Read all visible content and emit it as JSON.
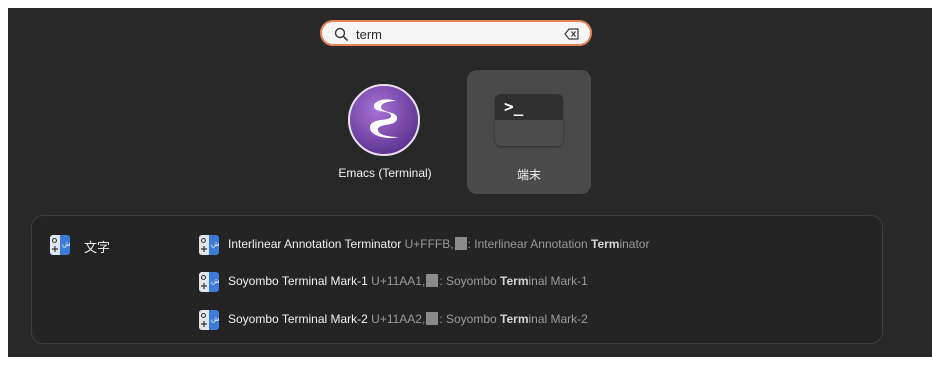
{
  "search": {
    "value": "term"
  },
  "apps": [
    {
      "name": "Emacs (Terminal)",
      "icon": "emacs-icon"
    },
    {
      "name": "端末",
      "icon": "terminal-icon",
      "selected": true
    }
  ],
  "results": {
    "provider": {
      "name": "文字",
      "icon": "characters-app-icon"
    },
    "items": [
      {
        "title": "Interlinear Annotation Terminator",
        "code": "U+FFFB,",
        "desc_prefix": ": Interlinear Annotation ",
        "desc_match": "Term",
        "desc_suffix": "inator"
      },
      {
        "title": "Soyombo Terminal Mark-1",
        "code": "U+11AA1,",
        "desc_prefix": ": Soyombo ",
        "desc_match": "Term",
        "desc_suffix": "inal Mark-1"
      },
      {
        "title": "Soyombo Terminal Mark-2",
        "code": "U+11AA2,",
        "desc_prefix": ": Soyombo ",
        "desc_match": "Term",
        "desc_suffix": "inal Mark-2"
      }
    ]
  },
  "colors": {
    "background": "#282828",
    "search_border": "#e9825b",
    "selected_tile": "#4a4a4a"
  }
}
